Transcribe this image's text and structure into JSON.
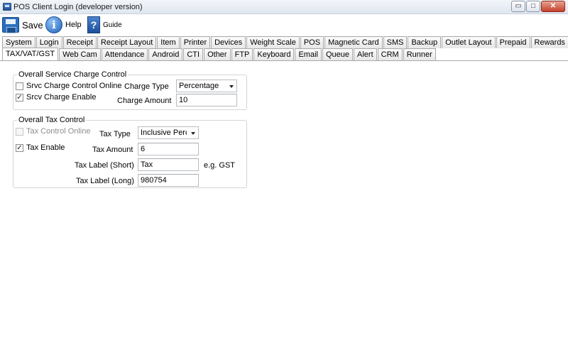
{
  "window": {
    "title": "POS Client Login (developer version)",
    "controls": {
      "minimize": "▭",
      "maximize": "□",
      "close": "✕"
    }
  },
  "toolbar": {
    "save_label": "Save",
    "help_label": "Help",
    "guide_label": "Guide",
    "help_glyph": "i",
    "guide_glyph": "?"
  },
  "tabs": {
    "row1": [
      "System",
      "Login",
      "Receipt",
      "Receipt Layout",
      "Item",
      "Printer",
      "Devices",
      "Weight Scale",
      "POS",
      "Magnetic Card",
      "SMS",
      "Backup",
      "Outlet Layout",
      "Prepaid",
      "Rewards"
    ],
    "row2": [
      "TAX/VAT/GST",
      "Web Cam",
      "Attendance",
      "Android",
      "CTI",
      "Other",
      "FTP",
      "Keyboard",
      "Email",
      "Queue",
      "Alert",
      "CRM",
      "Runner"
    ],
    "active": "TAX/VAT/GST"
  },
  "service_charge": {
    "group_title": "Overall Service Charge Control",
    "online_label": "Srvc Charge Control Online",
    "online_checked": false,
    "enable_label": "Srcv Charge Enable",
    "enable_checked": true,
    "type_label": "Charge Type",
    "type_value": "Percentage",
    "amount_label": "Charge Amount",
    "amount_value": "10"
  },
  "tax": {
    "group_title": "Overall Tax Control",
    "online_label": "Tax Control Online",
    "online_checked": false,
    "online_disabled": true,
    "enable_label": "Tax Enable",
    "enable_checked": true,
    "type_label": "Tax Type",
    "type_value": "Inclusive Perce",
    "amount_label": "Tax Amount",
    "amount_value": "6",
    "label_short_label": "Tax Label (Short)",
    "label_short_value": "Tax",
    "label_short_hint": "e.g. GST",
    "label_long_label": "Tax Label (Long)",
    "label_long_value": "980754"
  },
  "check_glyph": "✓"
}
